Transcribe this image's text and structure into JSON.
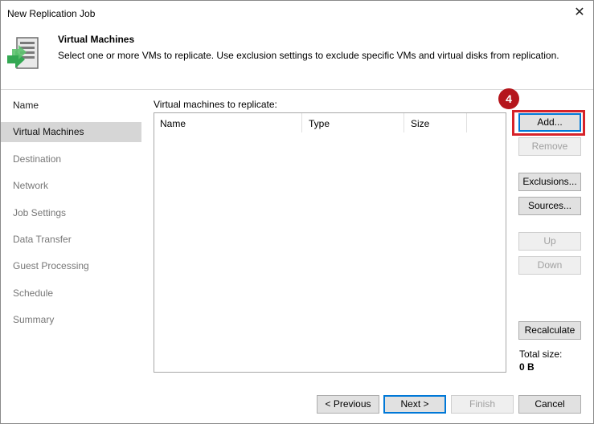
{
  "window": {
    "title": "New Replication Job",
    "close_glyph": "✕"
  },
  "header": {
    "icon": "vm-replicate-icon",
    "title": "Virtual Machines",
    "description": "Select one or more VMs to replicate. Use exclusion settings to exclude specific VMs and virtual disks from replication."
  },
  "sidebar": {
    "items": [
      {
        "label": "Name"
      },
      {
        "label": "Virtual Machines"
      },
      {
        "label": "Destination"
      },
      {
        "label": "Network"
      },
      {
        "label": "Job Settings"
      },
      {
        "label": "Data Transfer"
      },
      {
        "label": "Guest Processing"
      },
      {
        "label": "Schedule"
      },
      {
        "label": "Summary"
      }
    ]
  },
  "main": {
    "group_label": "Virtual machines to replicate:",
    "columns": [
      "Name",
      "Type",
      "Size"
    ],
    "rows": []
  },
  "actions": {
    "add": "Add...",
    "remove": "Remove",
    "exclusions": "Exclusions...",
    "sources": "Sources...",
    "up": "Up",
    "down": "Down",
    "recalculate": "Recalculate"
  },
  "total": {
    "label": "Total size:",
    "value": "0 B"
  },
  "annotation": {
    "step": "4",
    "color": "#d6232a"
  },
  "footer": {
    "previous": "< Previous",
    "next": "Next >",
    "finish": "Finish",
    "cancel": "Cancel"
  }
}
